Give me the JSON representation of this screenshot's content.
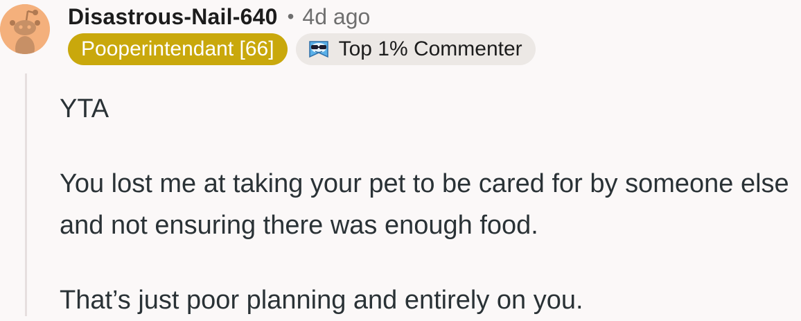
{
  "comment": {
    "username": "Disastrous-Nail-640",
    "separator": "•",
    "timestamp": "4d ago",
    "flair": "Pooperintendant [66]",
    "badge": {
      "label": "Top 1% Commenter",
      "icon": "sunglasses-snoo-icon"
    },
    "avatar": {
      "icon": "snoo-avatar-icon",
      "background_color": "#f4b07c"
    },
    "paragraphs": [
      "YTA",
      "You lost me at taking your pet to be cared for by someone else and not ensuring there was enough food.",
      "That’s just poor planning and entirely on you."
    ]
  },
  "colors": {
    "flair_background": "#c9a80c",
    "badge_background": "#ece8e5",
    "username_text": "#1c1c1c",
    "meta_text": "#6f6f6f",
    "body_text": "#2a3236",
    "thread_line": "#e6dfdf",
    "page_background": "#fbf8f8"
  }
}
